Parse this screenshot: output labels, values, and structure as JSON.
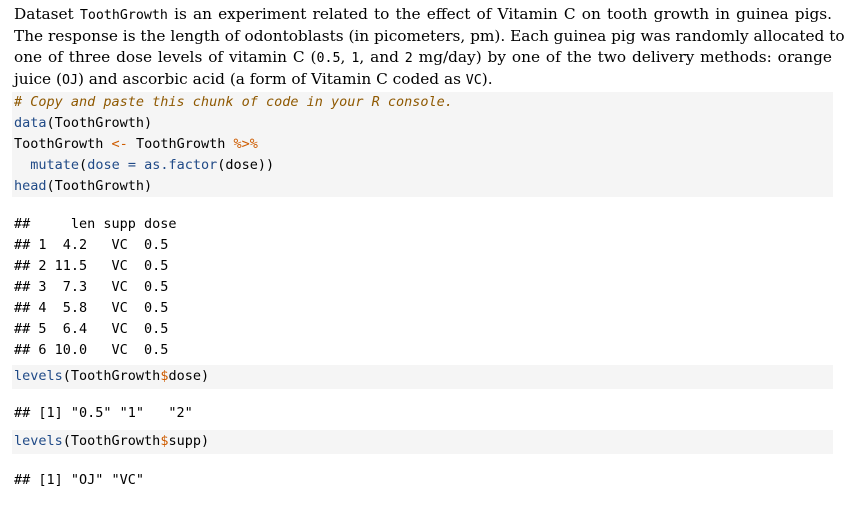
{
  "intro": {
    "l1_a": "Dataset ",
    "l1_code": "ToothGrowth",
    "l1_b": " is an experiment related to the effect of Vitamin C on tooth growth in guinea pigs.",
    "l2": "The response is the length of odontoblasts (in picometers, pm). Each guinea pig was randomly allocated to",
    "l3_a": "one of three dose levels of vitamin C (",
    "l3_c1": "0.5",
    "l3_b": ", ",
    "l3_c2": "1",
    "l3_c": ", and ",
    "l3_c3": "2",
    "l3_d": " mg/day) by one of the two delivery methods: orange",
    "l4_a": "juice (",
    "l4_c1": "OJ",
    "l4_b": ") and ascorbic acid (a form of Vitamin C coded as ",
    "l4_c2": "VC",
    "l4_c": ")."
  },
  "chunk1": {
    "comment": "# Copy and paste this chunk of code in your R console.",
    "l2_fn": "data",
    "l2_rest": "(ToothGrowth)",
    "l3_a": "ToothGrowth ",
    "l3_assign": "<-",
    "l3_b": " ToothGrowth ",
    "l3_pipe": "%>%",
    "l4_indent": "  ",
    "l4_fn": "mutate",
    "l4_a": "(",
    "l4_arg": "dose",
    "l4_b": " ",
    "l4_eq": "=",
    "l4_c": " ",
    "l4_fn2": "as.factor",
    "l4_d": "(dose))",
    "l5_fn": "head",
    "l5_rest": "(ToothGrowth)"
  },
  "head_output": [
    "##     len supp dose",
    "## 1  4.2   VC  0.5",
    "## 2 11.5   VC  0.5",
    "## 3  7.3   VC  0.5",
    "## 4  5.8   VC  0.5",
    "## 5  6.4   VC  0.5",
    "## 6 10.0   VC  0.5"
  ],
  "chunk2": {
    "fn": "levels",
    "a": "(ToothGrowth",
    "op": "$",
    "b": "dose)"
  },
  "output2": "## [1] \"0.5\" \"1\"   \"2\"",
  "chunk3": {
    "fn": "levels",
    "a": "(ToothGrowth",
    "op": "$",
    "b": "supp)"
  },
  "output3": "## [1] \"OJ\" \"VC\""
}
